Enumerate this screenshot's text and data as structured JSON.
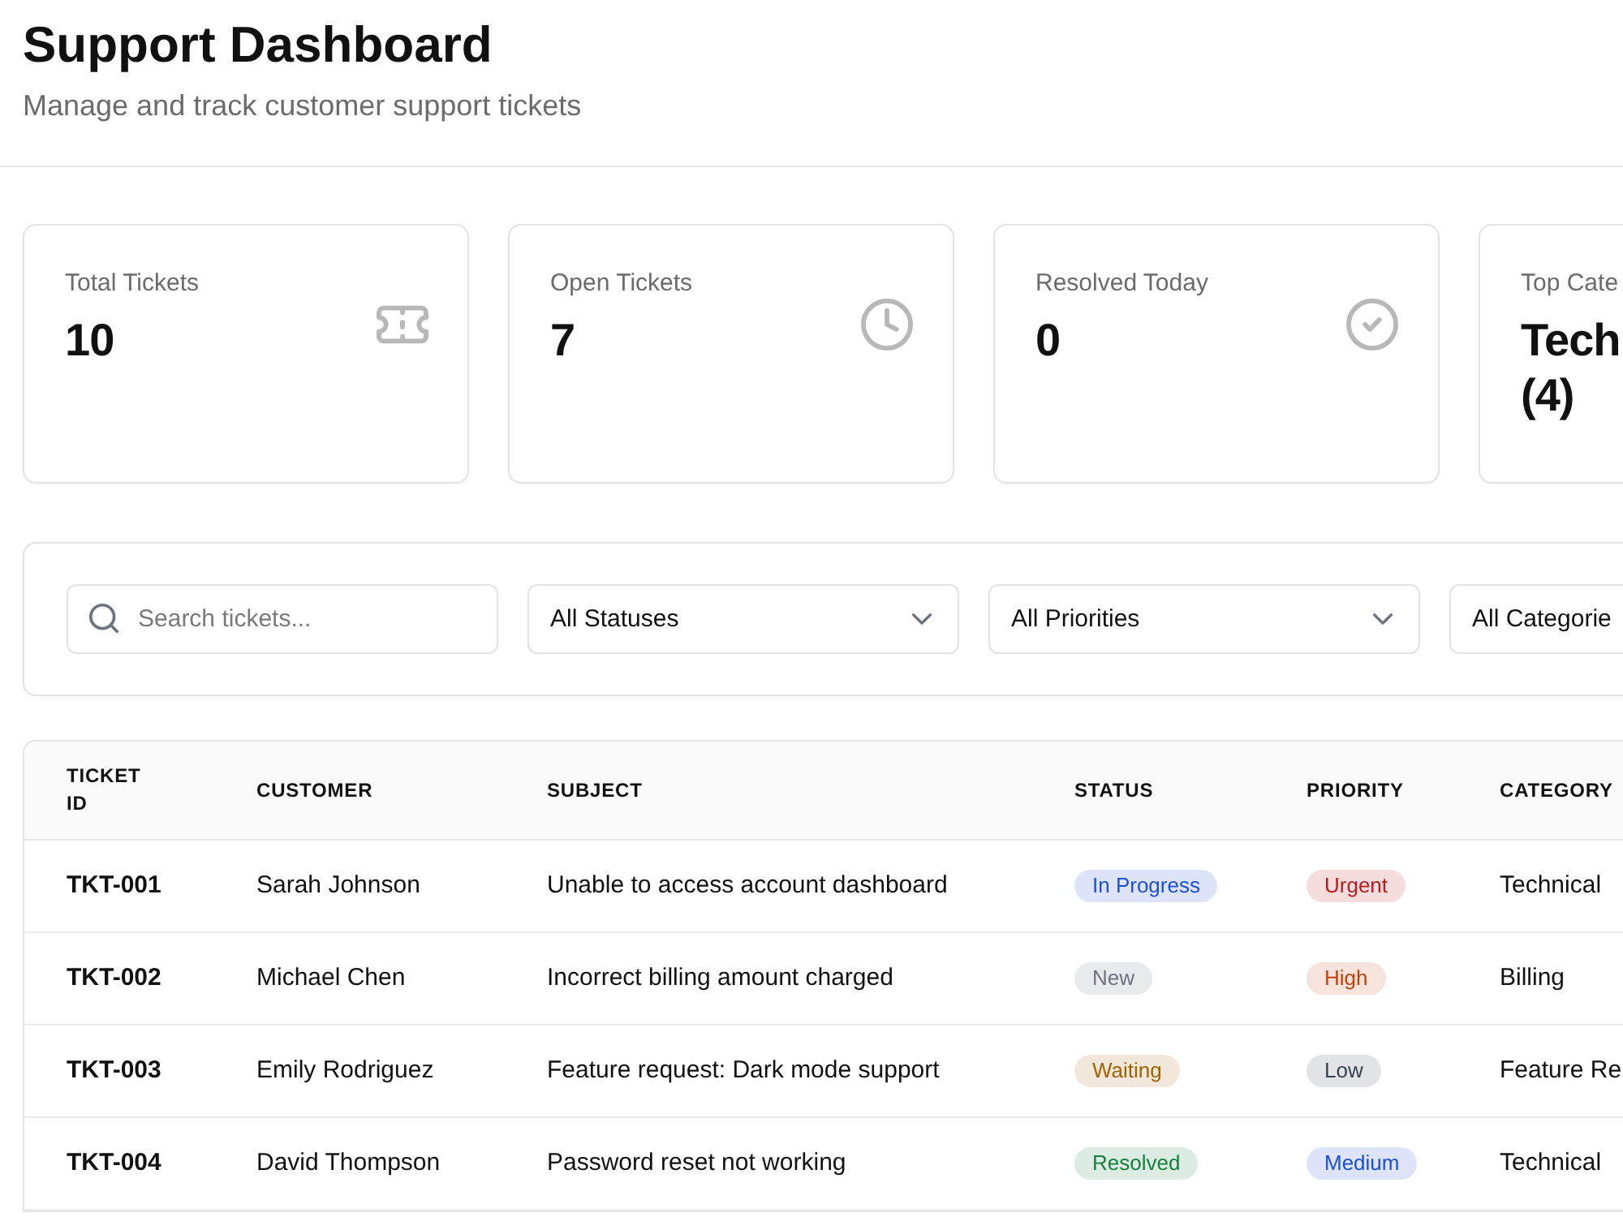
{
  "header": {
    "title": "Support Dashboard",
    "subtitle": "Manage and track customer support tickets"
  },
  "stats": [
    {
      "label": "Total Tickets",
      "value": "10"
    },
    {
      "label": "Open Tickets",
      "value": "7"
    },
    {
      "label": "Resolved Today",
      "value": "0"
    },
    {
      "label": "Top Cate",
      "value": "Tech (4)"
    }
  ],
  "filters": {
    "search": {
      "placeholder": "Search tickets..."
    },
    "dropdowns": [
      {
        "value": "All Statuses"
      },
      {
        "value": "All Priorities"
      },
      {
        "value": "All Categorie"
      }
    ]
  },
  "table": {
    "columns": [
      "TICKET ID",
      "CUSTOMER",
      "SUBJECT",
      "STATUS",
      "PRIORITY",
      "CATEGORY"
    ],
    "rows": [
      {
        "ticket_id": "TKT-001",
        "customer": "Sarah Johnson",
        "subject": "Unable to access account dashboard",
        "status": {
          "text": "In Progress",
          "color": "#1d4ed8"
        },
        "priority": {
          "text": "Urgent",
          "color": "#b91c1c"
        },
        "category": "Technical"
      },
      {
        "ticket_id": "TKT-002",
        "customer": "Michael Chen",
        "subject": "Incorrect billing amount charged",
        "status": {
          "text": "New",
          "color": "#6b7280"
        },
        "priority": {
          "text": "High",
          "color": "#c2410c"
        },
        "category": "Billing"
      },
      {
        "ticket_id": "TKT-003",
        "customer": "Emily Rodriguez",
        "subject": "Feature request: Dark mode support",
        "status": {
          "text": "Waiting",
          "color": "#a16207"
        },
        "priority": {
          "text": "Low",
          "color": "#374151"
        },
        "category": "Feature Re"
      },
      {
        "ticket_id": "TKT-004",
        "customer": "David Thompson",
        "subject": "Password reset not working",
        "status": {
          "text": "Resolved",
          "color": "#15803d"
        },
        "priority": {
          "text": "Medium",
          "color": "#1d4ed8"
        },
        "category": "Technical"
      }
    ]
  }
}
